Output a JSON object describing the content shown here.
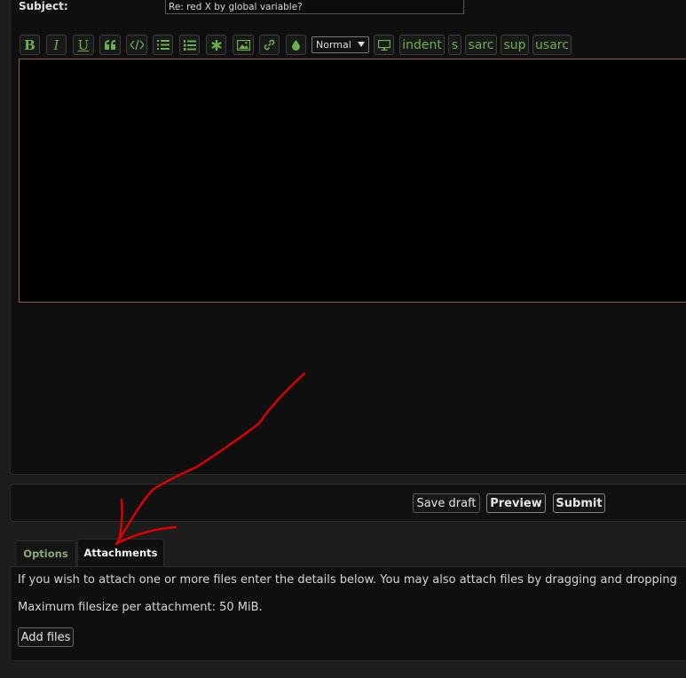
{
  "form": {
    "subject_label": "Subject:",
    "subject_value": "Re: red X by global variable?"
  },
  "toolbar": {
    "bold": "B",
    "italic": "I",
    "underline": "U",
    "font_size_selected": "Normal",
    "custom_buttons": [
      "indent",
      "s",
      "sarc",
      "sup",
      "usarc"
    ],
    "icons": [
      "quote-icon",
      "code-icon",
      "list-icon",
      "ordered-list-icon",
      "asterisk-icon",
      "image-icon",
      "link-icon",
      "color-drop-icon",
      "monitor-icon"
    ]
  },
  "editor": {
    "value": ""
  },
  "actions": {
    "save_draft": "Save draft",
    "preview": "Preview",
    "submit": "Submit"
  },
  "tabs": {
    "options": "Options",
    "attachments": "Attachments"
  },
  "attachments": {
    "instructions": "If you wish to attach one or more files enter the details below. You may also attach files by dragging and dropping",
    "max_size": "Maximum filesize per attachment: 50 MiB.",
    "add_files": "Add files"
  },
  "annotation": {
    "arrow_color": "#e00000"
  },
  "colors": {
    "accent_green": "#6ab04c",
    "editor_border": "#9a5a50"
  }
}
